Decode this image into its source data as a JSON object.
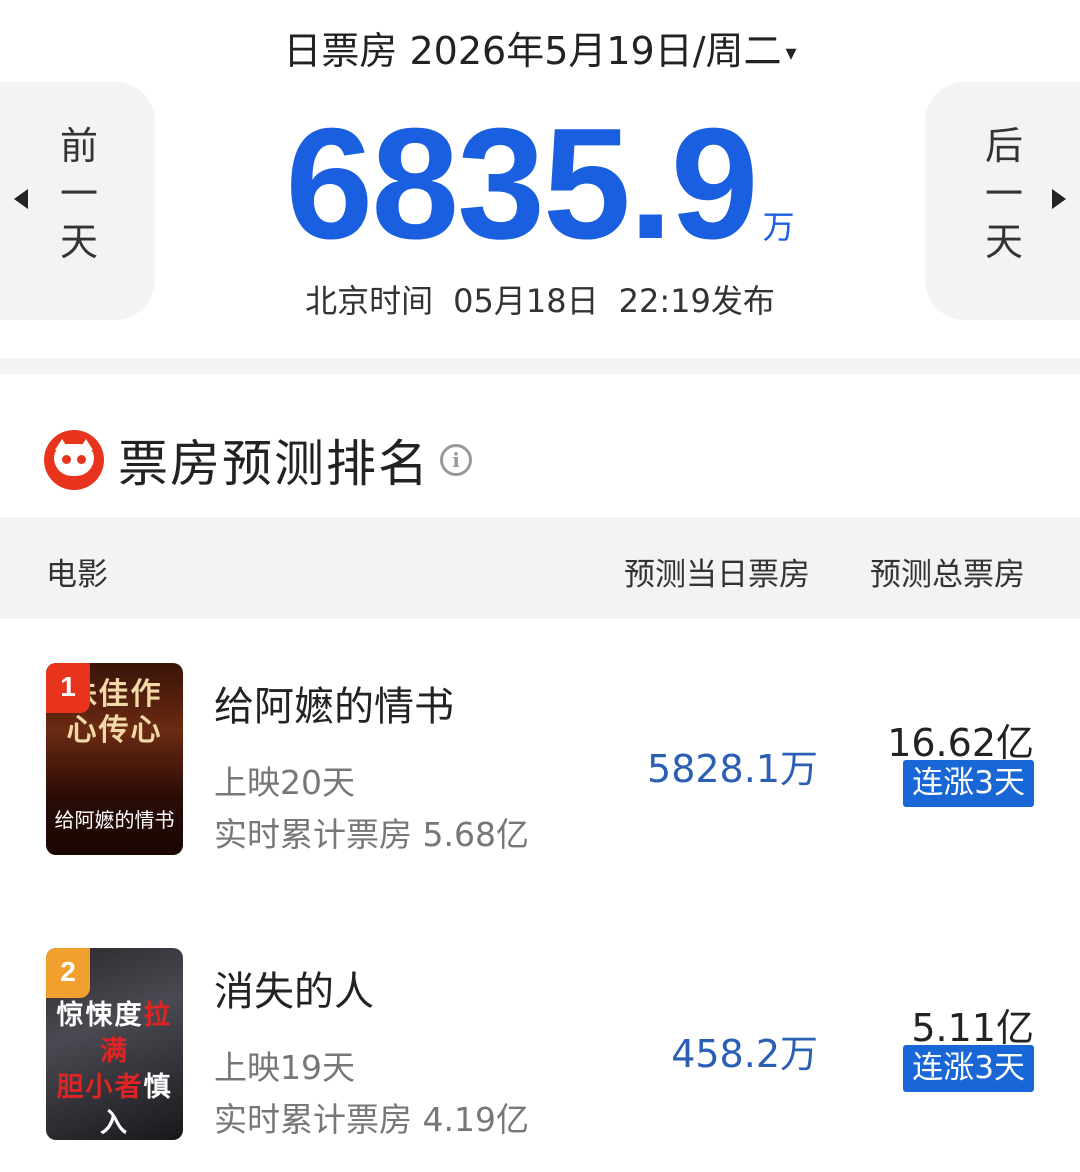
{
  "header": {
    "title": "日票房 2026年5月19日/周二",
    "caret": "▾"
  },
  "nav": {
    "prev": "前一天",
    "next": "后一天"
  },
  "summary": {
    "total_value": "6835.9",
    "unit": "万",
    "publish_prefix": "北京时间",
    "publish_date": "05月18日",
    "publish_time": "22:19发布"
  },
  "section": {
    "title": "票房预测排名",
    "info": "i"
  },
  "table": {
    "headers": {
      "movie": "电影",
      "daily": "预测当日票房",
      "total": "预测总票房"
    },
    "rows": [
      {
        "rank": "1",
        "title": "给阿嬷的情书",
        "days": "上映20天",
        "cumulative": "实时累计票房 5.68亿",
        "daily": "5828.1万",
        "total": "16.62亿",
        "tag": "连涨3天"
      },
      {
        "rank": "2",
        "title": "消失的人",
        "days": "上映19天",
        "cumulative": "实时累计票房 4.19亿",
        "daily": "458.2万",
        "total": "5.11亿",
        "tag": "连涨3天"
      }
    ]
  },
  "colors": {
    "accent_blue": "#1a5fe0",
    "tag_blue": "#1966d6",
    "rank1_red": "#e8341c",
    "rank2_orange": "#f2a02d"
  }
}
